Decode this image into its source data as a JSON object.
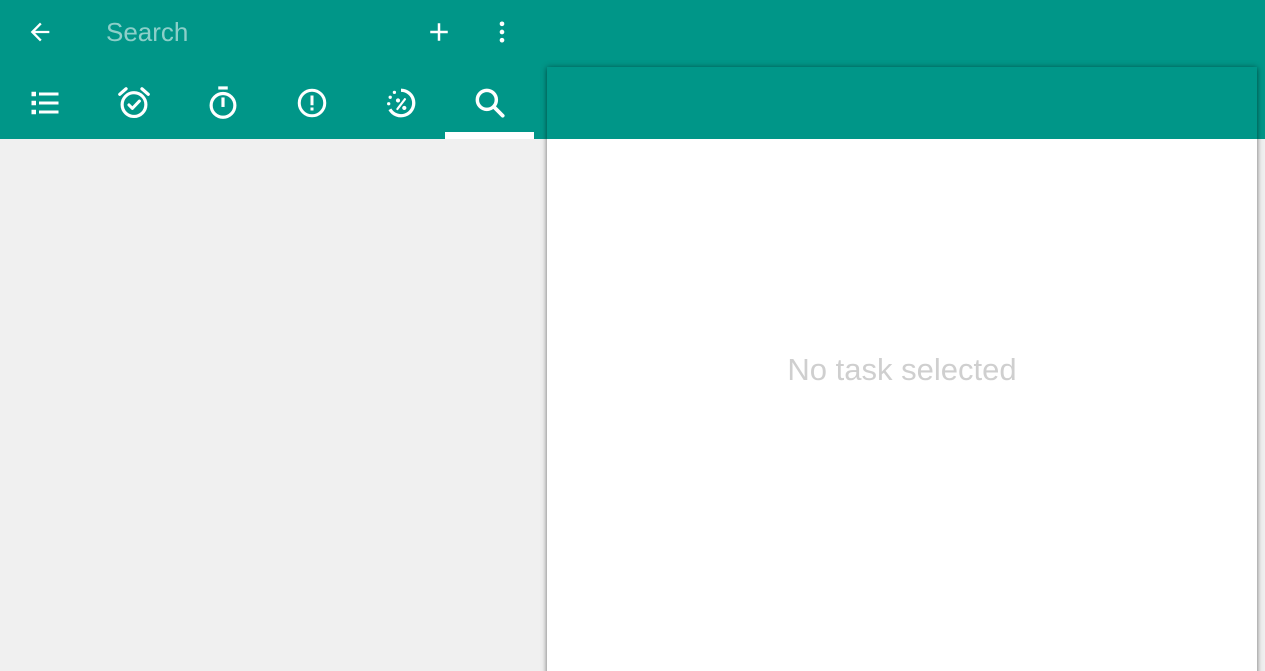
{
  "colors": {
    "primary": "#009688",
    "on_primary": "#ffffff",
    "background": "#f0f0f0",
    "card": "#ffffff",
    "empty_text": "#cfcfcf"
  },
  "toolbar": {
    "back_icon": "arrow-back-icon",
    "search_placeholder": "Search",
    "search_value": "",
    "add_icon": "plus-icon",
    "more_icon": "more-vert-icon"
  },
  "tabs": [
    {
      "icon": "list-icon",
      "selected": false
    },
    {
      "icon": "alarm-check-icon",
      "selected": false
    },
    {
      "icon": "stopwatch-icon",
      "selected": false
    },
    {
      "icon": "alert-circle-icon",
      "selected": false
    },
    {
      "icon": "progress-percent-icon",
      "selected": false
    },
    {
      "icon": "search-icon",
      "selected": true
    }
  ],
  "detail": {
    "empty_message": "No task selected"
  }
}
